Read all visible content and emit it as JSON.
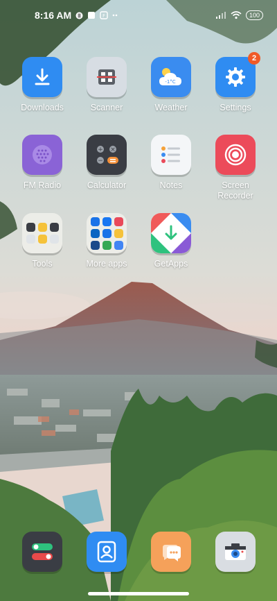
{
  "status_bar": {
    "time": "8:16 AM",
    "battery": "100"
  },
  "apps": [
    {
      "label": "Downloads",
      "icon": "download-icon",
      "color": "#2f8cf2"
    },
    {
      "label": "Scanner",
      "icon": "scanner-icon",
      "color": "#d7dde3"
    },
    {
      "label": "Weather",
      "icon": "weather-icon",
      "color": "#3a8cf0",
      "temp": "-1°C"
    },
    {
      "label": "Settings",
      "icon": "gear-icon",
      "color": "#2f8cf2",
      "badge": "2"
    },
    {
      "label": "FM Radio",
      "icon": "radio-icon",
      "color": "#8a63d6"
    },
    {
      "label": "Calculator",
      "icon": "calculator-icon",
      "color": "#3a3d44"
    },
    {
      "label": "Notes",
      "icon": "notes-icon",
      "color": "#f4f6f8"
    },
    {
      "label": "Screen Recorder",
      "icon": "screen-recorder-icon",
      "color": "#ec4b5a"
    },
    {
      "label": "Tools",
      "icon": "tools-folder-icon",
      "color": "#eeeeea"
    },
    {
      "label": "More apps",
      "icon": "more-apps-folder-icon",
      "color": "#eeeeea"
    },
    {
      "label": "GetApps",
      "icon": "getapps-icon",
      "color": "#ffffff"
    }
  ],
  "dock": [
    {
      "icon": "phone-icon",
      "color": "#3a3d44"
    },
    {
      "icon": "contacts-icon",
      "color": "#2f8cf2"
    },
    {
      "icon": "messages-icon",
      "color": "#f5a15a"
    },
    {
      "icon": "camera-icon",
      "color": "#d9dde2"
    }
  ]
}
